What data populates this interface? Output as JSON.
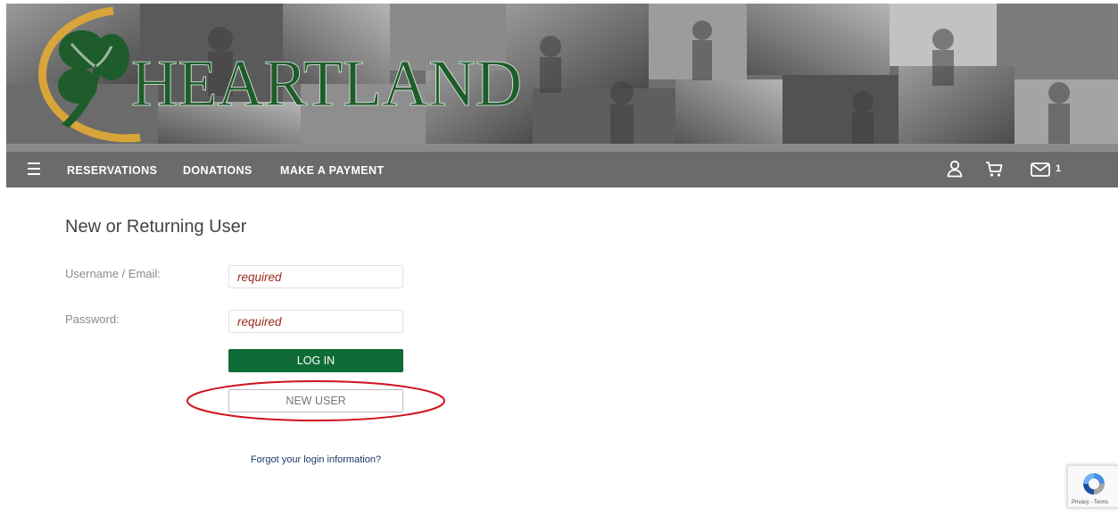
{
  "brand": {
    "name": "HEARTLAND",
    "color": "#1e5c2b",
    "ring_color": "#d8a53a"
  },
  "nav": {
    "items": [
      {
        "label": "RESERVATIONS"
      },
      {
        "label": "DONATIONS"
      },
      {
        "label": "MAKE A PAYMENT"
      }
    ],
    "icons": [
      "menu-icon",
      "user-icon",
      "cart-icon",
      "mail-icon"
    ],
    "message_count": "1"
  },
  "login": {
    "title": "New or Returning User",
    "username_label": "Username / Email:",
    "username_placeholder": "required",
    "password_label": "Password:",
    "password_placeholder": "required",
    "login_button": "LOG IN",
    "new_user_button": "NEW USER",
    "forgot_link": "Forgot your login information?"
  },
  "recaptcha": {
    "terms": "Privacy - Terms",
    "icon": "recaptcha-icon"
  },
  "colors": {
    "login_button": "#0e6b36",
    "nav_bar": "#6b6b6b",
    "annotation": "#d0121b",
    "placeholder": "#9b2a1e"
  }
}
